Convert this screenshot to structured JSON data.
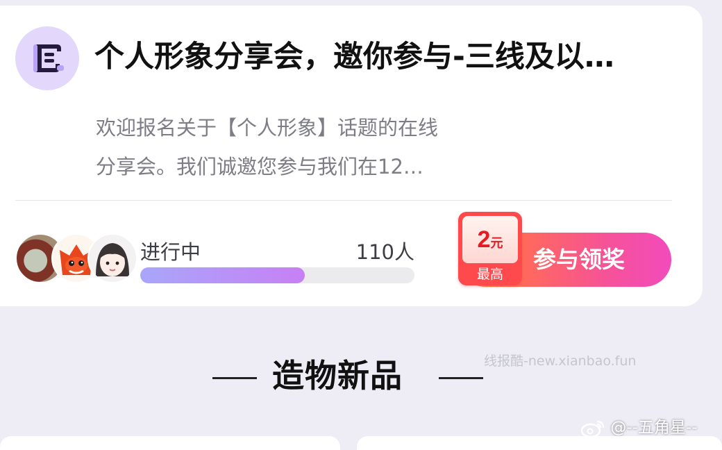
{
  "topic_card": {
    "icon": "scroll-icon",
    "title": "个人形象分享会，邀你参与-三线及以…",
    "description_lines": [
      "欢迎报名关于【个人形象】话题的在线",
      "分享会。我们诚邀您参与我们在12…"
    ],
    "status": "进行中",
    "participants": "110人",
    "progress_fraction": 0.6,
    "reward": {
      "amount": "2",
      "unit": "元",
      "caption": "最高"
    },
    "join_label": "参与领奖"
  },
  "section": {
    "title": "造物新品"
  },
  "watermark": "线报酷-new.xianbao.fun",
  "credit": "@--五角星--",
  "colors": {
    "page_bg": "#eeedf6",
    "progress_start": "#a9a6fa",
    "progress_end": "#c780f4",
    "button_start": "#ff8f1e",
    "button_end": "#f24bbc",
    "reward_red": "#ff4a4d"
  }
}
